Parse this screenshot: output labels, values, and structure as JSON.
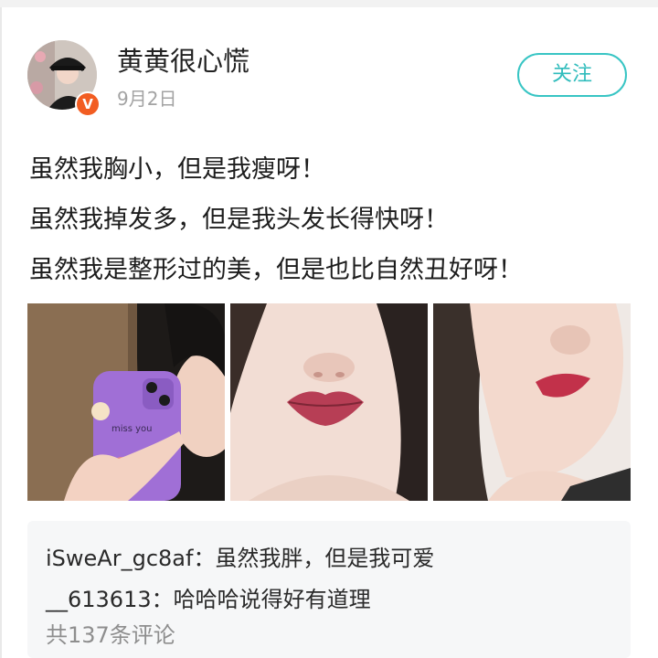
{
  "post": {
    "author": {
      "name": "黄黄很心慌",
      "verified_badge": "V"
    },
    "date": "9月2日",
    "follow_label": "关注",
    "text_lines": [
      "虽然我胸小，但是我瘦呀！",
      "虽然我掉发多，但是我头发长得快呀！",
      "虽然我是整形过的美，但是也比自然丑好呀！"
    ],
    "images": [
      {
        "name": "mirror-selfie-photo",
        "phone_case_text": "miss you"
      },
      {
        "name": "lips-closeup-photo"
      },
      {
        "name": "side-face-photo"
      }
    ],
    "comments": [
      {
        "author": "iSweAr_gc8af",
        "separator": "：",
        "text": "虽然我胖，但是我可爱"
      },
      {
        "author": "__613613",
        "separator": "：",
        "text": "哈哈哈说得好有道理"
      }
    ],
    "comment_count_label": "共137条评论"
  },
  "colors": {
    "accent": "#38c5c4",
    "badge": "#f25d22",
    "muted": "#a3a3a3",
    "comment_bg": "#f6f7f8"
  }
}
